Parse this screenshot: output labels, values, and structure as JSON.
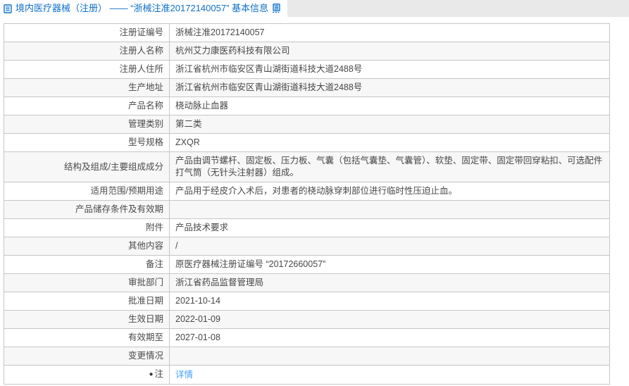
{
  "header": {
    "title": "境内医疗器械（注册） —— “浙械注准20172140057” 基本信息",
    "title_color": "#0d6fc8",
    "tabbar_bg": "#e9e9e9",
    "leading_icon": "document-icon",
    "trailing_icon": "form-icon"
  },
  "table": {
    "alt_row_bg": "#f7f7f7",
    "border_color": "#c6c6c6",
    "link_color": "#409eff",
    "rows": [
      {
        "label": "注册证编号",
        "value": "浙械注准20172140057"
      },
      {
        "label": "注册人名称",
        "value": "杭州艾力康医药科技有限公司"
      },
      {
        "label": "注册人住所",
        "value": "浙江省杭州市临安区青山湖街道科技大道2488号"
      },
      {
        "label": "生产地址",
        "value": "浙江省杭州市临安区青山湖街道科技大道2488号"
      },
      {
        "label": "产品名称",
        "value": "桡动脉止血器"
      },
      {
        "label": "管理类别",
        "value": "第二类"
      },
      {
        "label": "型号规格",
        "value": "ZXQR"
      },
      {
        "label": "结构及组成/主要组成成分",
        "value": "产品由调节螺杆、固定板、压力板、气囊（包括气囊垫、气囊管）、软垫、固定带、固定带回穿粘扣、可选配件打气筒（无针头注射器）组成。"
      },
      {
        "label": "适用范围/预期用途",
        "value": "产品用于经皮介入术后，对患者的桡动脉穿刺部位进行临时性压迫止血。"
      },
      {
        "label": "产品储存条件及有效期",
        "value": ""
      },
      {
        "label": "附件",
        "value": "产品技术要求"
      },
      {
        "label": "其他内容",
        "value": "/"
      },
      {
        "label": "备注",
        "value": "原医疗器械注册证编号 “20172660057”"
      },
      {
        "label": "审批部门",
        "value": "浙江省药品监督管理局"
      },
      {
        "label": "批准日期",
        "value": "2021-10-14"
      },
      {
        "label": "生效日期",
        "value": "2022-01-09"
      },
      {
        "label": "有效期至",
        "value": "2027-01-08"
      },
      {
        "label": "变更情况",
        "value": ""
      },
      {
        "label": "注",
        "label_icon": "bulb-icon",
        "label_icon_glyph": "●",
        "value": "详情",
        "is_link": true
      }
    ]
  }
}
